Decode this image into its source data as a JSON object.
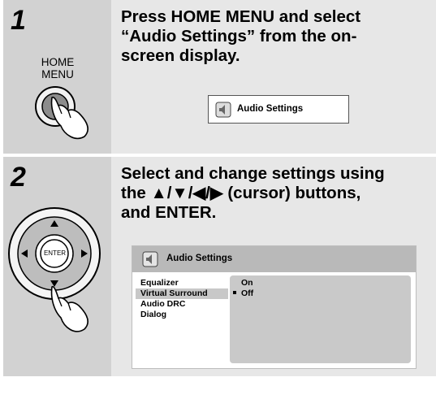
{
  "step1": {
    "number": "1",
    "button_label_line1": "HOME",
    "button_label_line2": "MENU",
    "instruction_line1": "Press HOME MENU and select",
    "instruction_line2": "“Audio Settings” from the on-",
    "instruction_line3": "screen display.",
    "screen_item_label": "Audio Settings"
  },
  "step2": {
    "number": "2",
    "enter_button_label": "ENTER",
    "instruction_line1": "Select and change settings using",
    "instruction_line2": "the ▲/▼/◀/▶ (cursor) buttons,",
    "instruction_line3": "and ENTER.",
    "screen": {
      "title": "Audio Settings",
      "menu_items": [
        {
          "label": "Equalizer",
          "selected": false
        },
        {
          "label": "Virtual Surround",
          "selected": true
        },
        {
          "label": "Audio DRC",
          "selected": false
        },
        {
          "label": "Dialog",
          "selected": false
        }
      ],
      "options": [
        {
          "label": "On",
          "current": false
        },
        {
          "label": "Off",
          "current": true
        }
      ]
    }
  }
}
